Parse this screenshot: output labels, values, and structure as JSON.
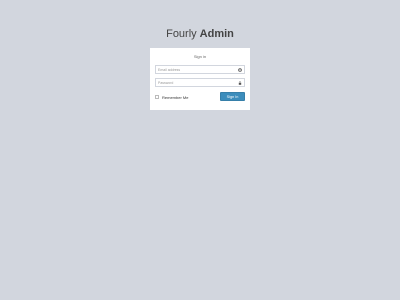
{
  "logo": {
    "light_text": "Fourly",
    "bold_text": "Admin"
  },
  "login": {
    "message": "Sign in",
    "email_placeholder": "Email address",
    "password_placeholder": "Password",
    "remember_label": "Remember Me",
    "submit_label": "Sign In"
  },
  "colors": {
    "background": "#d2d6de",
    "box": "#ffffff",
    "button": "#3c8dbc"
  },
  "icons": {
    "email": "envelope-icon",
    "password": "lock-icon"
  }
}
